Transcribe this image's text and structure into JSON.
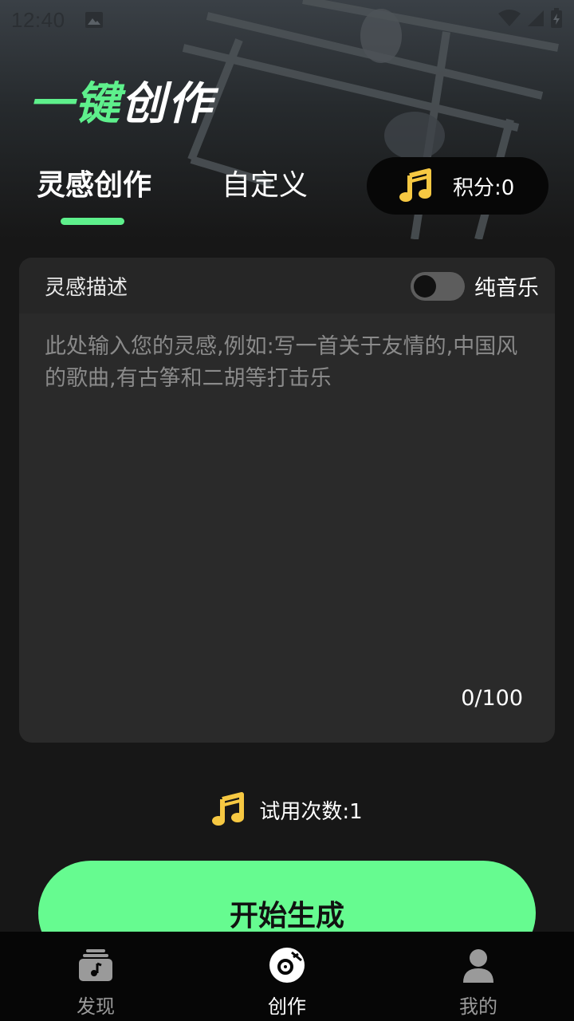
{
  "status_bar": {
    "time": "12:40"
  },
  "header": {
    "title_green": "一键",
    "title_white": "创作"
  },
  "tabs": [
    {
      "label": "灵感创作",
      "active": true
    },
    {
      "label": "自定义",
      "active": false
    }
  ],
  "points": {
    "label": "积分:0",
    "icon": "music-note-icon"
  },
  "card": {
    "label": "灵感描述",
    "toggle_label": "纯音乐",
    "toggle_on": false,
    "placeholder": "此处输入您的灵感,例如:写一首关于友情的,中国风的歌曲,有古筝和二胡等打击乐",
    "counter": "0/100"
  },
  "trial": {
    "label": "试用次数:1",
    "icon": "music-note-icon"
  },
  "start_button": {
    "label": "开始生成"
  },
  "bottom_nav": [
    {
      "label": "发现",
      "icon": "discover-icon",
      "active": false
    },
    {
      "label": "创作",
      "icon": "disc-icon",
      "active": true
    },
    {
      "label": "我的",
      "icon": "user-icon",
      "active": false
    }
  ],
  "colors": {
    "accent": "#5ef08c",
    "button": "#66fb90",
    "background": "#171717",
    "card": "#2a2a2a"
  }
}
